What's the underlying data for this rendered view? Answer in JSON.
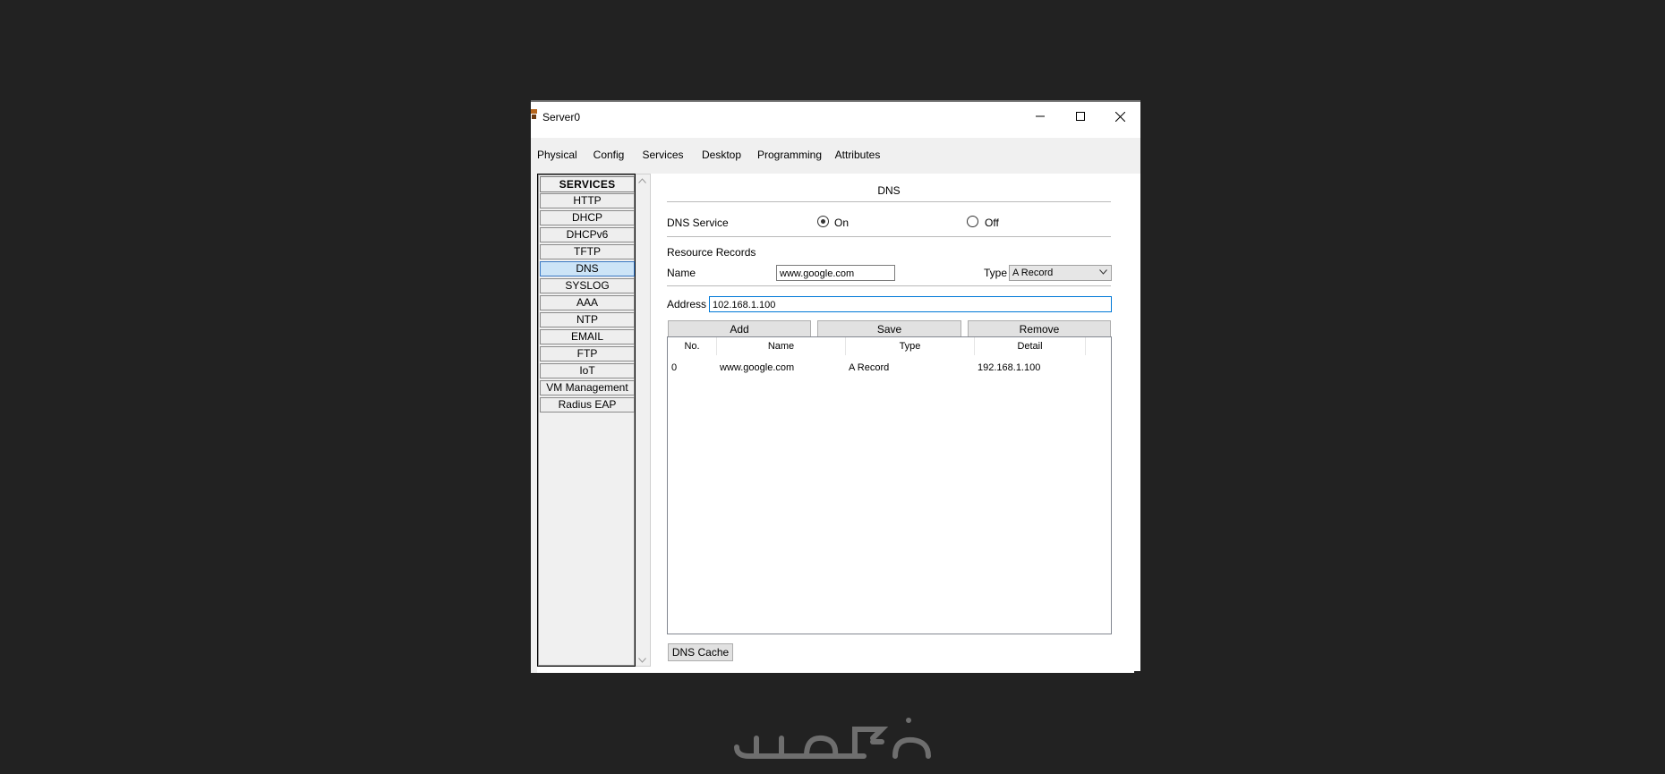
{
  "window": {
    "title": "Server0"
  },
  "colors": {
    "background": "#222222",
    "accent": "#1e2a45",
    "selection": "#cce4f7",
    "focus_border": "#0078d7"
  },
  "icons": [
    "app-icon",
    "minimize-icon",
    "maximize-icon",
    "close-icon",
    "scroll-up-icon",
    "scroll-down-icon",
    "radio-checked-icon",
    "radio-unchecked-icon",
    "chevron-down-icon"
  ],
  "tabs": [
    {
      "label": "Physical"
    },
    {
      "label": "Config"
    },
    {
      "label": "Services",
      "active": true
    },
    {
      "label": "Desktop"
    },
    {
      "label": "Programming"
    },
    {
      "label": "Attributes"
    }
  ],
  "services": {
    "header": "SERVICES",
    "items": [
      "HTTP",
      "DHCP",
      "DHCPv6",
      "TFTP",
      "DNS",
      "SYSLOG",
      "AAA",
      "NTP",
      "EMAIL",
      "FTP",
      "IoT",
      "VM Management",
      "Radius EAP"
    ],
    "selected": "DNS"
  },
  "dns": {
    "title": "DNS",
    "service_label": "DNS Service",
    "on_label": "On",
    "off_label": "Off",
    "service_state": "On",
    "resource_records_label": "Resource Records",
    "name_label": "Name",
    "name_value": "www.google.com",
    "type_label": "Type",
    "type_value": "A Record",
    "address_label": "Address",
    "address_value": "102.168.1.100",
    "add_label": "Add",
    "save_label": "Save",
    "remove_label": "Remove",
    "table": {
      "columns": [
        "No.",
        "Name",
        "Type",
        "Detail"
      ],
      "rows": [
        {
          "no": "0",
          "name": "www.google.com",
          "type": "A Record",
          "detail": "192.168.1.100"
        }
      ]
    },
    "cache_label": "DNS Cache"
  },
  "watermark": "خمسات"
}
